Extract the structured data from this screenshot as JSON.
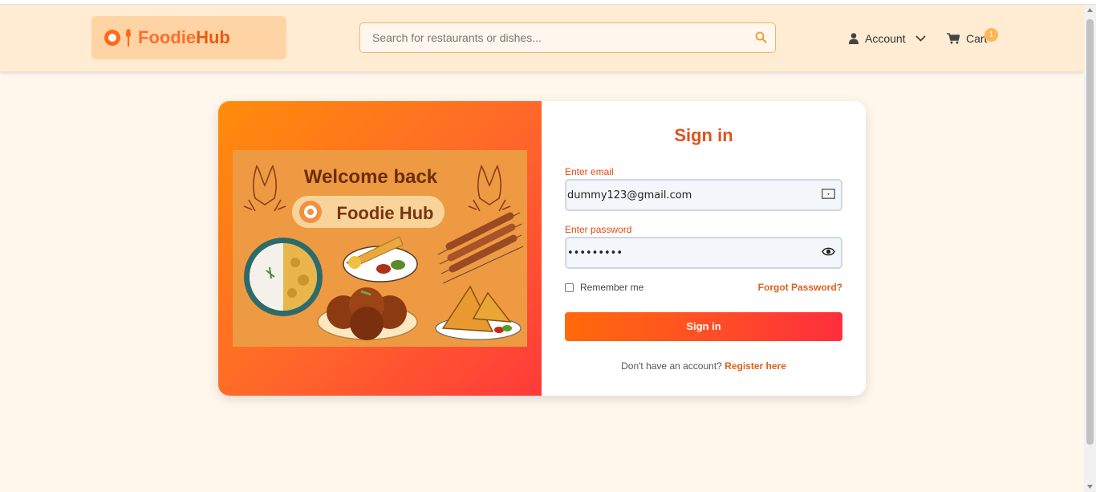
{
  "header": {
    "logo_part1": "Foodie",
    "logo_part2": "Hub",
    "search_placeholder": "Search for restaurants or dishes...",
    "account_label": "Account",
    "cart_label": "Cart",
    "cart_count": "1"
  },
  "promo": {
    "headline": "Welcome back",
    "brand": "Foodie Hub"
  },
  "form": {
    "title": "Sign in",
    "email_label": "Enter email",
    "email_value": "dummy123@gmail.com",
    "password_label": "Enter password",
    "password_value": "•••••••••",
    "remember_label": "Remember me",
    "forgot_label": "Forgot Password?",
    "submit_label": "Sign in",
    "register_prompt": "Don't have an account?",
    "register_link": "Register here"
  },
  "colors": {
    "accent": "#e0521a",
    "header_bg": "#ffecd2",
    "page_bg": "#fff6ec"
  }
}
